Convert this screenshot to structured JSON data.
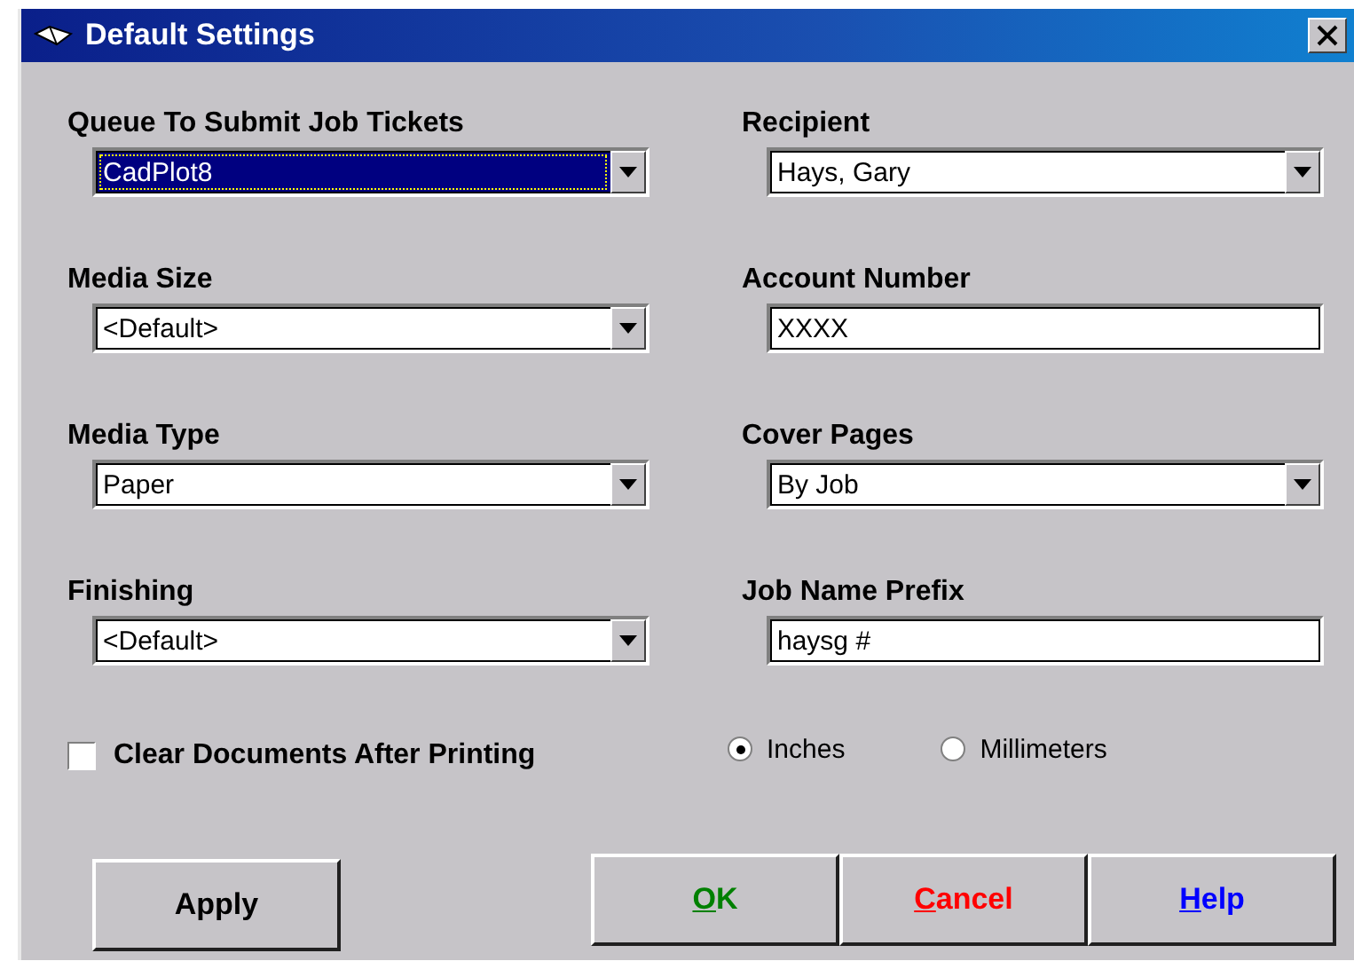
{
  "window": {
    "title": "Default Settings"
  },
  "left_fields": [
    {
      "label": "Queue To Submit Job Tickets",
      "kind": "combo",
      "value": "CadPlot8",
      "focused": true
    },
    {
      "label": "Media Size",
      "kind": "combo",
      "value": "<Default>",
      "focused": false
    },
    {
      "label": "Media Type",
      "kind": "combo",
      "value": "Paper",
      "focused": false
    },
    {
      "label": "Finishing",
      "kind": "combo",
      "value": "<Default>",
      "focused": false
    }
  ],
  "right_fields": [
    {
      "label": "Recipient",
      "kind": "combo",
      "value": "Hays, Gary",
      "focused": false
    },
    {
      "label": "Account Number",
      "kind": "text",
      "value": "XXXX",
      "focused": false
    },
    {
      "label": "Cover Pages",
      "kind": "combo",
      "value": "By Job",
      "focused": false
    },
    {
      "label": "Job Name Prefix",
      "kind": "text",
      "value": "haysg #",
      "focused": false
    }
  ],
  "checkbox": {
    "label": "Clear Documents After Printing",
    "checked": false
  },
  "units": [
    {
      "label": "Inches",
      "selected": true
    },
    {
      "label": "Millimeters",
      "selected": false
    }
  ],
  "apply_button": {
    "label": "Apply"
  },
  "buttons": [
    {
      "mnemonic": "O",
      "rest": "K",
      "color": "#008000"
    },
    {
      "mnemonic": "C",
      "rest": "ancel",
      "color": "#ff0000"
    },
    {
      "mnemonic": "H",
      "rest": "elp",
      "color": "#0000ff"
    }
  ]
}
